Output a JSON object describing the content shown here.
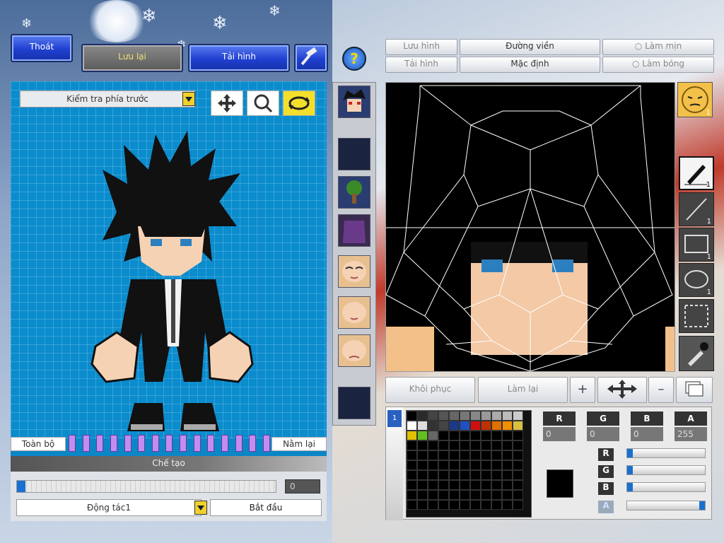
{
  "top": {
    "exit_label": "Thoát",
    "save_label": "Lưu lại",
    "reload_label": "Tải hình"
  },
  "left": {
    "view_select": "Kiểm tra phía trước",
    "all_label": "Toàn bộ",
    "lie_label": "Nằm lại",
    "create_label": "Chế tạo",
    "slider_value": "0",
    "action_select": "Động tác1",
    "start_label": "Bắt đầu"
  },
  "editor": {
    "save_image": "Lưu hình",
    "load_image": "Tải hình",
    "outline": "Đường viền",
    "default": "Mặc định",
    "smooth": "Làm mịn",
    "shadow": "Làm bóng",
    "restore": "Khôi phục",
    "redo": "Làm lại"
  },
  "tools": {
    "brush_count": "1",
    "line_count": "1",
    "rect_count": "1",
    "ellipse_count": "1",
    "face_count": "1"
  },
  "color": {
    "r_label": "R",
    "g_label": "G",
    "b_label": "B",
    "a_label": "A",
    "r_value": "0",
    "g_value": "0",
    "b_value": "0",
    "a_value": "255",
    "current": "#000000",
    "palette_row1": [
      "#000000",
      "#2a2a2a",
      "#444444",
      "#555555",
      "#666666",
      "#777777",
      "#888888",
      "#999999",
      "#aaaaaa",
      "#bbbbbb",
      "#cccccc"
    ],
    "palette_row2": [
      "#ffffff",
      "#dddddd",
      "#333333",
      "#444444",
      "#1a3a8a",
      "#2050c0",
      "#d01010",
      "#c03000",
      "#e07000",
      "#f09000",
      "#d8c040"
    ],
    "palette_row3": [
      "#e0c000",
      "#60c020",
      "#666666"
    ]
  }
}
